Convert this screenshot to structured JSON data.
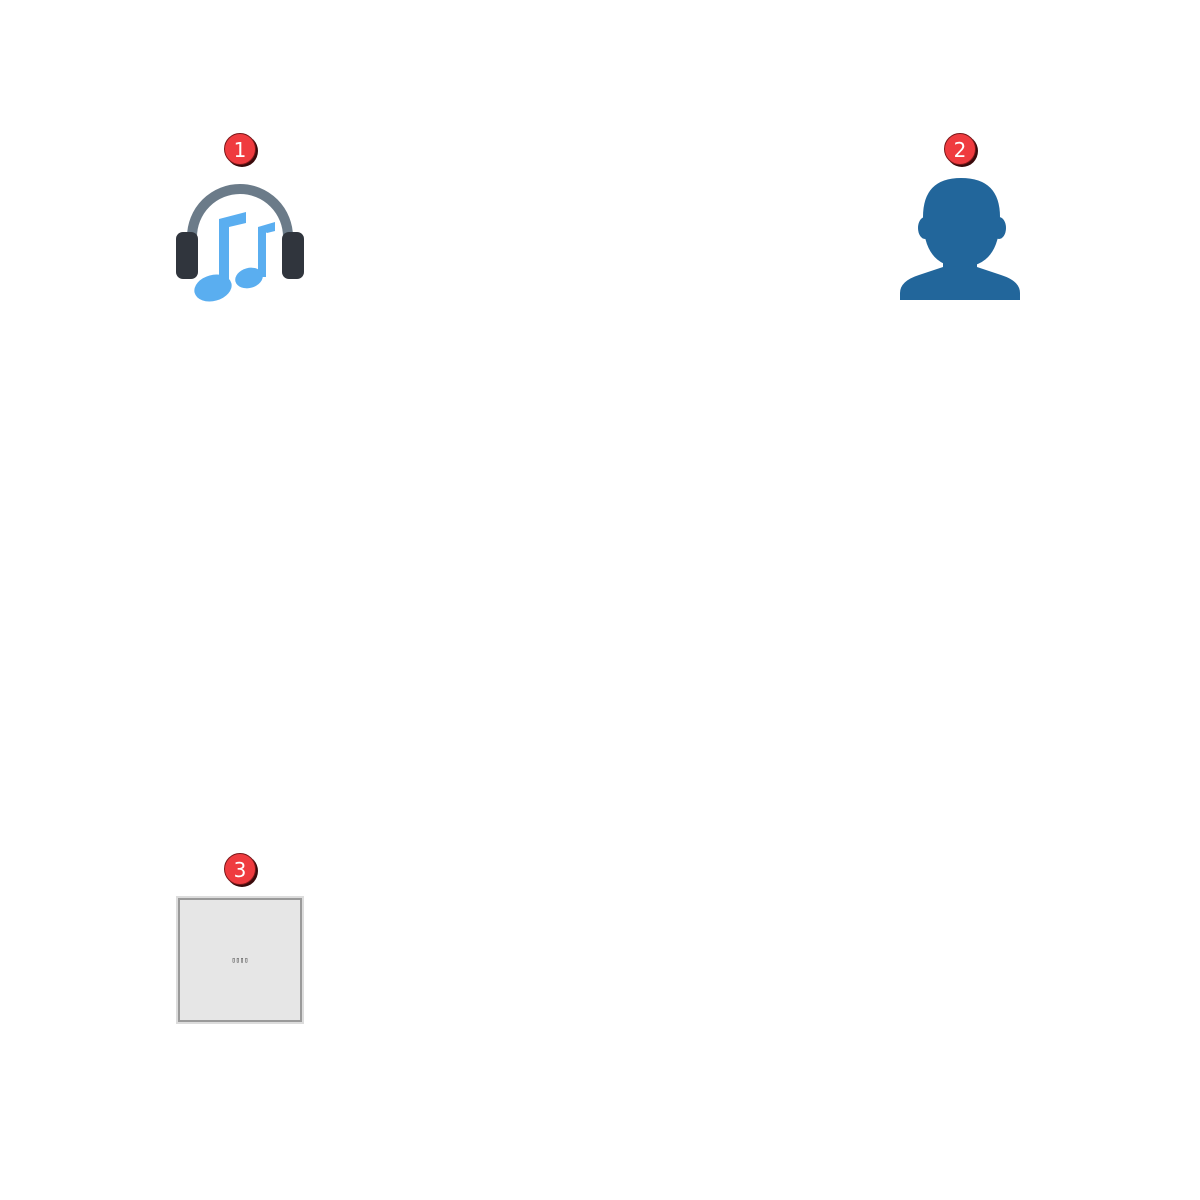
{
  "items": [
    {
      "badge": "1",
      "icon": "headphones-music-icon"
    },
    {
      "badge": "2",
      "icon": "user-silhouette-icon"
    },
    {
      "badge": "3",
      "icon": "missing-glyph-tile",
      "tile_text": "▯▯▯▯"
    }
  ],
  "colors": {
    "badge": "#ef3b3f",
    "headphone_band": "#6b7b89",
    "headphone_cups": "#30353d",
    "music_notes": "#5aaef0",
    "user": "#22669b",
    "tile_bg": "#e6e6e6",
    "tile_border": "#9a9a9a"
  }
}
